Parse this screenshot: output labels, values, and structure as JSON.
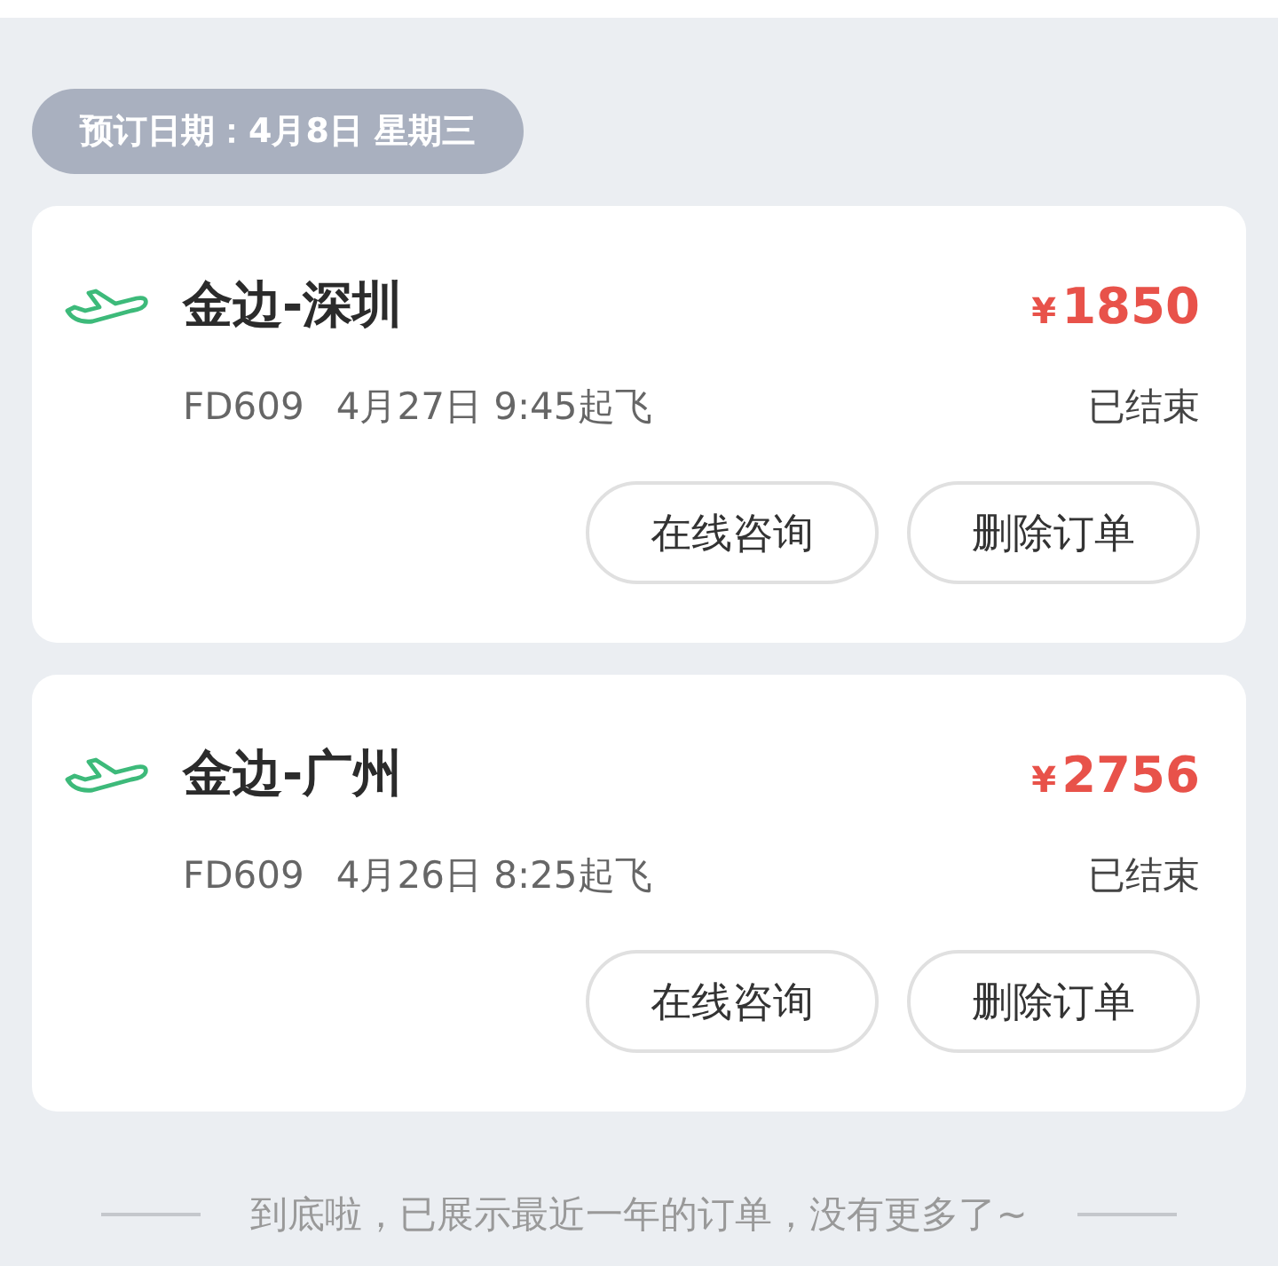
{
  "booking_date": "预订日期：4月8日 星期三",
  "orders": [
    {
      "route": "金边-深圳",
      "currency": "¥",
      "amount": "1850",
      "flight": "FD609",
      "departure": "4月27日 9:45起飞",
      "status": "已结束",
      "buttons": [
        "在线咨询",
        "删除订单"
      ]
    },
    {
      "route": "金边-广州",
      "currency": "¥",
      "amount": "2756",
      "flight": "FD609",
      "departure": "4月26日 8:25起飞",
      "status": "已结束",
      "buttons": [
        "在线咨询",
        "删除订单"
      ]
    }
  ],
  "footer": "到底啦，已展示最近一年的订单，没有更多了~"
}
